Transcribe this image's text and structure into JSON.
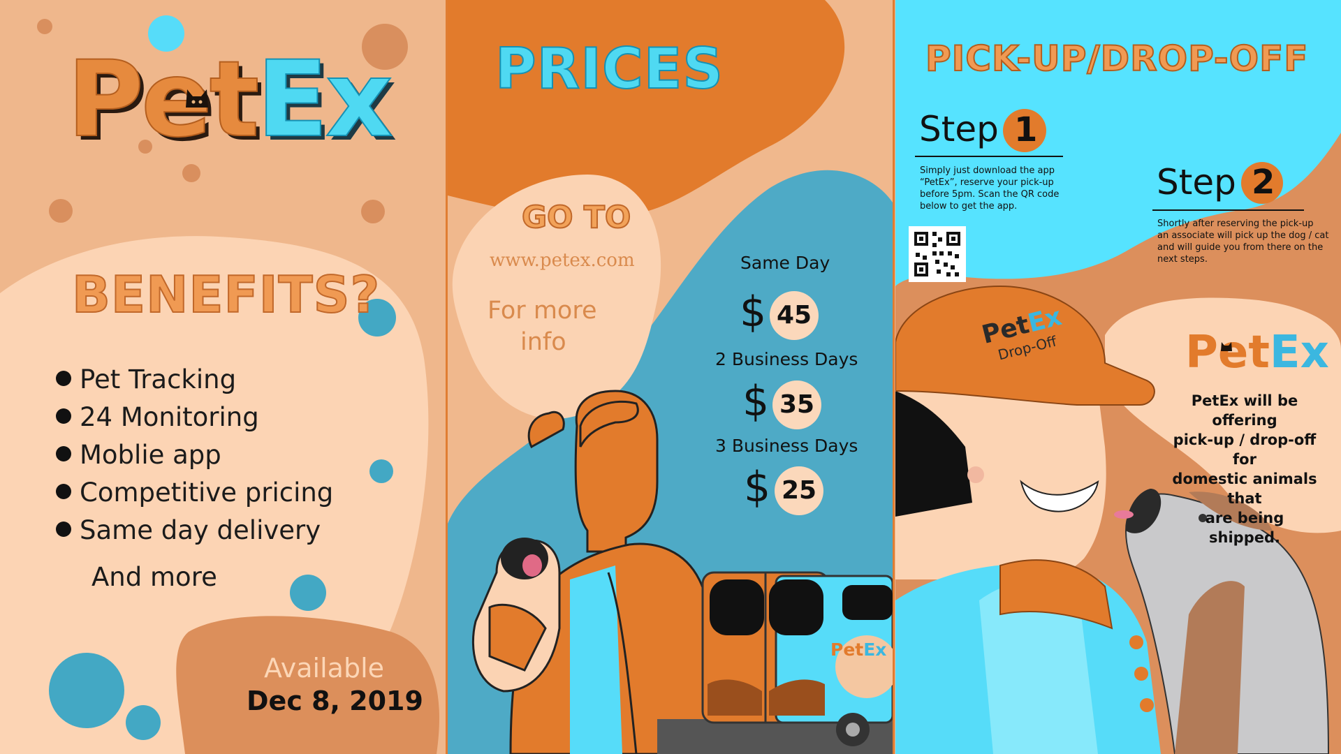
{
  "colors": {
    "orange": "#e27b2c",
    "light_peach": "#fbd3b3",
    "peach": "#efb78c",
    "cyan": "#55e3ff",
    "teal": "#4faac6",
    "dark": "#111111"
  },
  "panel1": {
    "logo": {
      "pet": "Pet",
      "ex": "Ex"
    },
    "benefits_heading": "BENEFITS?",
    "benefits": [
      "Pet Tracking",
      "24 Monitoring",
      "Moblie app",
      "Competitive pricing",
      "Same day delivery"
    ],
    "more": "And more",
    "available_label": "Available",
    "available_date": "Dec 8, 2019"
  },
  "panel2": {
    "heading": "PRICES",
    "goto_label": "GO TO",
    "url": "www.petex.com",
    "info_line1": "For more",
    "info_line2": "info",
    "currency": "$",
    "prices": [
      {
        "label": "Same Day",
        "amount": "45"
      },
      {
        "label": "2 Business Days",
        "amount": "35"
      },
      {
        "label": "3 Business Days",
        "amount": "25"
      }
    ],
    "van_logo": {
      "pet": "Pet",
      "ex": "Ex"
    }
  },
  "panel3": {
    "heading": "PICK-UP/DROP-OFF",
    "step_word": "Step",
    "step1": {
      "number": "1",
      "text": [
        "Simply just download the app",
        "“PetEx”, reserve your pick-up",
        "before 5pm. Scan the QR code",
        "below to get the app."
      ]
    },
    "step2": {
      "number": "2",
      "text": [
        "Shortly after reserving the pick-up",
        "an associate will pick up the dog / cat",
        "and will guide you from there on the",
        "next steps."
      ]
    },
    "cap_logo": {
      "pet": "Pet",
      "ex": "Ex",
      "sub": "Drop-Off"
    },
    "logo": {
      "pet": "Pet",
      "ex": "Ex"
    },
    "offer_text": [
      "PetEx will be offering",
      "pick-up / drop-off for",
      "domestic animals that",
      "are being shipped."
    ],
    "icons": [
      "qr-code-icon",
      "cat-face-icon"
    ]
  }
}
